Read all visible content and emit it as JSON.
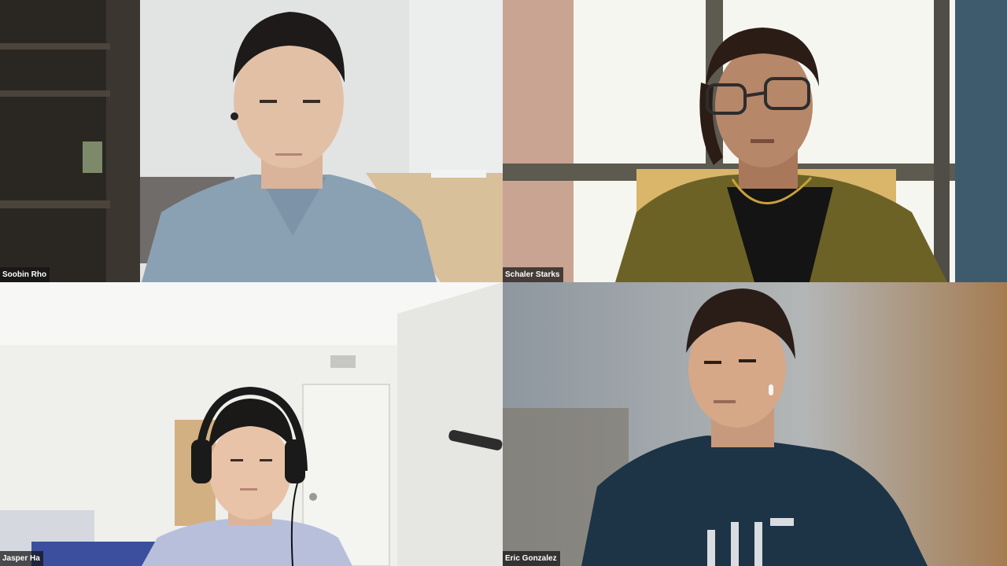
{
  "participants": [
    {
      "name": "Soobin Rho"
    },
    {
      "name": "Schaler Starks"
    },
    {
      "name": "Jasper Ha"
    },
    {
      "name": "Eric Gonzalez"
    }
  ]
}
